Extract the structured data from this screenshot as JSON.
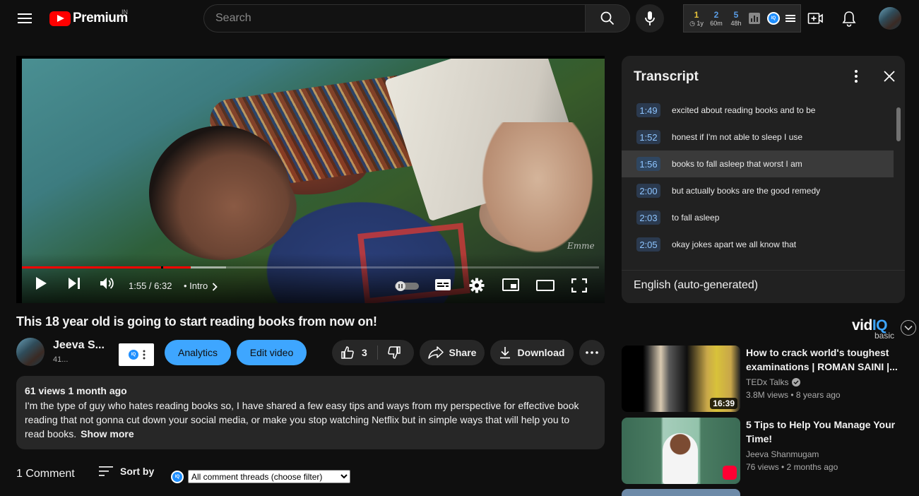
{
  "header": {
    "logo_text": "Premium",
    "country_code": "IN",
    "search_placeholder": "Search",
    "vidiq_stats": [
      {
        "value": "1",
        "label": "1y",
        "color": "yellow",
        "has_clock": true
      },
      {
        "value": "2",
        "label": "60m",
        "color": "blue"
      },
      {
        "value": "5",
        "label": "48h",
        "color": "blue"
      }
    ],
    "vidiq_small_text": "IQ"
  },
  "player": {
    "current_time": "1:55",
    "duration": "6:32",
    "time_text": "1:55 / 6:32",
    "chapter": "Intro",
    "watermark": "Emme",
    "progress_fraction": 0.293,
    "buffer_fraction": 0.354
  },
  "transcript": {
    "title": "Transcript",
    "language": "English (auto-generated)",
    "segments": [
      {
        "time": "1:49",
        "text": "excited about reading books and to be"
      },
      {
        "time": "1:52",
        "text": "honest if I'm not able to sleep I use"
      },
      {
        "time": "1:56",
        "text": "books to fall asleep that worst I am",
        "active": true
      },
      {
        "time": "2:00",
        "text": "but actually books are the good remedy"
      },
      {
        "time": "2:03",
        "text": "to fall asleep"
      },
      {
        "time": "2:05",
        "text": "okay jokes apart we all know that"
      }
    ]
  },
  "video": {
    "title": "This 18 year old is going to start reading books from now on!",
    "channel_name": "Jeeva S...",
    "subscribers": "41...",
    "analytics_label": "Analytics",
    "edit_label": "Edit video",
    "likes": "3",
    "share_label": "Share",
    "download_label": "Download",
    "views_date": "61 views  1 month ago",
    "description": "I'm the type of guy who hates reading books so, I have shared a few easy tips and ways from my perspective for effective book reading that not gonna cut down your social media, or make you stop watching Netflix but in simple ways that will help you to read books.",
    "show_more": "Show more"
  },
  "comments": {
    "count_label": "1 Comment",
    "sort_label": "Sort by",
    "filter_selected": "All comment threads (choose filter)"
  },
  "sidebar": {
    "vidiq_brand_a": "vid",
    "vidiq_brand_b": "IQ",
    "vidiq_tier": "basic",
    "recommendations": [
      {
        "title": "How to crack world's toughest examinations | ROMAN SAINI |...",
        "channel": "TEDx Talks",
        "verified": true,
        "meta": "3.8M views  •  8 years ago",
        "duration": "16:39"
      },
      {
        "title": "5 Tips to Help You Manage Your Time!",
        "channel": "Jeeva Shanmugam",
        "verified": false,
        "meta": "76 views  •  2 months ago",
        "shorts": true
      }
    ]
  },
  "colors": {
    "background": "#0f0f0f",
    "accent_blue": "#3ea6ff",
    "progress_red": "#ff0000",
    "surface": "#272727"
  }
}
